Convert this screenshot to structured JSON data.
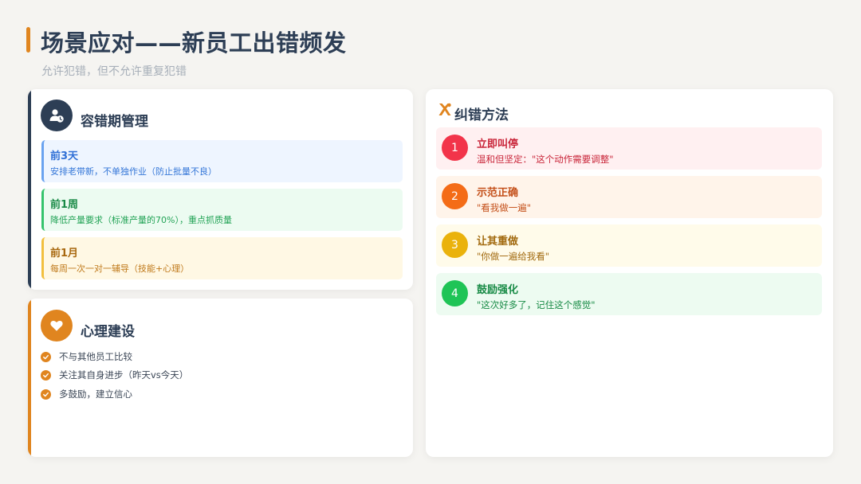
{
  "header": {
    "title": "场景应对——新员工出错频发",
    "subtitle": "允许犯错，但不允许重复犯错"
  },
  "tolerance": {
    "heading": "容错期管理",
    "icon": "user-clock-icon",
    "phases": [
      {
        "title": "前3天",
        "desc": "安排老带新，不单独作业（防止批量不良）",
        "color": "#2f6fd6",
        "bg": "#eef5ff",
        "border": "#6aa3f0"
      },
      {
        "title": "前1周",
        "desc": "降低产量要求（标准产量的70%），重点抓质量",
        "color": "#1f9a4f",
        "bg": "#ecfbf1",
        "border": "#36c46d"
      },
      {
        "title": "前1月",
        "desc": "每周一次一对一辅导（技能+心理）",
        "color": "#b8741b",
        "bg": "#fff8e4",
        "border": "#f2bf3e"
      }
    ]
  },
  "psychology": {
    "heading": "心理建设",
    "icon": "heart-icon",
    "items": [
      "不与其他员工比较",
      "关注其自身进步（昨天vs今天）",
      "多鼓励，建立信心"
    ]
  },
  "correction": {
    "heading": "纠错方法",
    "icon": "tools-icon",
    "steps": [
      {
        "num": "1",
        "title": "立即叫停",
        "desc": "温和但坚定：\"这个动作需要调整\"",
        "color": "#c9263a",
        "circle": "#f2344a",
        "bg": "#fff0f1"
      },
      {
        "num": "2",
        "title": "示范正确",
        "desc": "\"看我做一遍\"",
        "color": "#c4501a",
        "circle": "#f46c17",
        "bg": "#fff4ea"
      },
      {
        "num": "3",
        "title": "让其重做",
        "desc": "\"你做一遍给我看\"",
        "color": "#a26a0f",
        "circle": "#eab20c",
        "bg": "#fffbea"
      },
      {
        "num": "4",
        "title": "鼓励强化",
        "desc": "\"这次好多了，记住这个感觉\"",
        "color": "#178a45",
        "circle": "#1fc456",
        "bg": "#edfbf1"
      }
    ]
  },
  "colors": {
    "accent_orange": "#e0851f",
    "navy": "#2d3e55"
  }
}
